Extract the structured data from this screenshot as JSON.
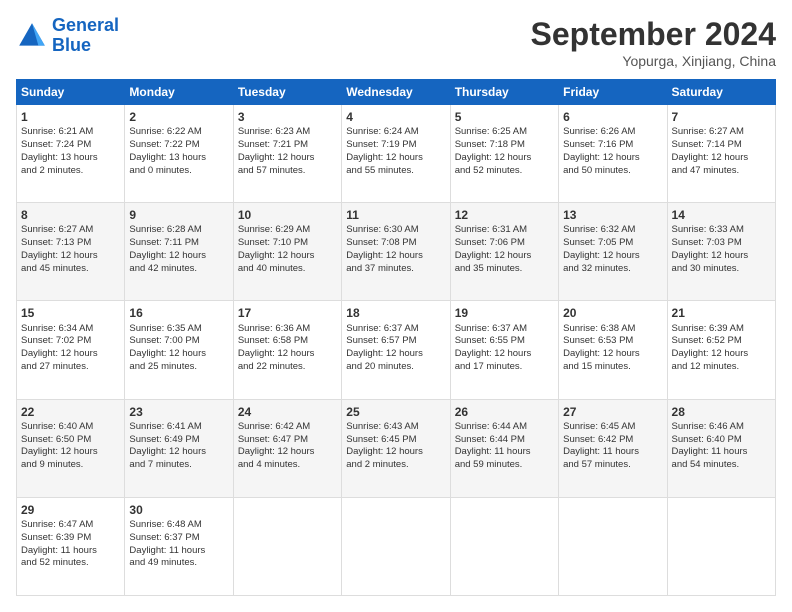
{
  "header": {
    "logo_line1": "General",
    "logo_line2": "Blue",
    "month_title": "September 2024",
    "subtitle": "Yopurga, Xinjiang, China"
  },
  "days_of_week": [
    "Sunday",
    "Monday",
    "Tuesday",
    "Wednesday",
    "Thursday",
    "Friday",
    "Saturday"
  ],
  "weeks": [
    [
      {
        "day": "1",
        "lines": [
          "Sunrise: 6:21 AM",
          "Sunset: 7:24 PM",
          "Daylight: 13 hours",
          "and 2 minutes."
        ]
      },
      {
        "day": "2",
        "lines": [
          "Sunrise: 6:22 AM",
          "Sunset: 7:22 PM",
          "Daylight: 13 hours",
          "and 0 minutes."
        ]
      },
      {
        "day": "3",
        "lines": [
          "Sunrise: 6:23 AM",
          "Sunset: 7:21 PM",
          "Daylight: 12 hours",
          "and 57 minutes."
        ]
      },
      {
        "day": "4",
        "lines": [
          "Sunrise: 6:24 AM",
          "Sunset: 7:19 PM",
          "Daylight: 12 hours",
          "and 55 minutes."
        ]
      },
      {
        "day": "5",
        "lines": [
          "Sunrise: 6:25 AM",
          "Sunset: 7:18 PM",
          "Daylight: 12 hours",
          "and 52 minutes."
        ]
      },
      {
        "day": "6",
        "lines": [
          "Sunrise: 6:26 AM",
          "Sunset: 7:16 PM",
          "Daylight: 12 hours",
          "and 50 minutes."
        ]
      },
      {
        "day": "7",
        "lines": [
          "Sunrise: 6:27 AM",
          "Sunset: 7:14 PM",
          "Daylight: 12 hours",
          "and 47 minutes."
        ]
      }
    ],
    [
      {
        "day": "8",
        "lines": [
          "Sunrise: 6:27 AM",
          "Sunset: 7:13 PM",
          "Daylight: 12 hours",
          "and 45 minutes."
        ]
      },
      {
        "day": "9",
        "lines": [
          "Sunrise: 6:28 AM",
          "Sunset: 7:11 PM",
          "Daylight: 12 hours",
          "and 42 minutes."
        ]
      },
      {
        "day": "10",
        "lines": [
          "Sunrise: 6:29 AM",
          "Sunset: 7:10 PM",
          "Daylight: 12 hours",
          "and 40 minutes."
        ]
      },
      {
        "day": "11",
        "lines": [
          "Sunrise: 6:30 AM",
          "Sunset: 7:08 PM",
          "Daylight: 12 hours",
          "and 37 minutes."
        ]
      },
      {
        "day": "12",
        "lines": [
          "Sunrise: 6:31 AM",
          "Sunset: 7:06 PM",
          "Daylight: 12 hours",
          "and 35 minutes."
        ]
      },
      {
        "day": "13",
        "lines": [
          "Sunrise: 6:32 AM",
          "Sunset: 7:05 PM",
          "Daylight: 12 hours",
          "and 32 minutes."
        ]
      },
      {
        "day": "14",
        "lines": [
          "Sunrise: 6:33 AM",
          "Sunset: 7:03 PM",
          "Daylight: 12 hours",
          "and 30 minutes."
        ]
      }
    ],
    [
      {
        "day": "15",
        "lines": [
          "Sunrise: 6:34 AM",
          "Sunset: 7:02 PM",
          "Daylight: 12 hours",
          "and 27 minutes."
        ]
      },
      {
        "day": "16",
        "lines": [
          "Sunrise: 6:35 AM",
          "Sunset: 7:00 PM",
          "Daylight: 12 hours",
          "and 25 minutes."
        ]
      },
      {
        "day": "17",
        "lines": [
          "Sunrise: 6:36 AM",
          "Sunset: 6:58 PM",
          "Daylight: 12 hours",
          "and 22 minutes."
        ]
      },
      {
        "day": "18",
        "lines": [
          "Sunrise: 6:37 AM",
          "Sunset: 6:57 PM",
          "Daylight: 12 hours",
          "and 20 minutes."
        ]
      },
      {
        "day": "19",
        "lines": [
          "Sunrise: 6:37 AM",
          "Sunset: 6:55 PM",
          "Daylight: 12 hours",
          "and 17 minutes."
        ]
      },
      {
        "day": "20",
        "lines": [
          "Sunrise: 6:38 AM",
          "Sunset: 6:53 PM",
          "Daylight: 12 hours",
          "and 15 minutes."
        ]
      },
      {
        "day": "21",
        "lines": [
          "Sunrise: 6:39 AM",
          "Sunset: 6:52 PM",
          "Daylight: 12 hours",
          "and 12 minutes."
        ]
      }
    ],
    [
      {
        "day": "22",
        "lines": [
          "Sunrise: 6:40 AM",
          "Sunset: 6:50 PM",
          "Daylight: 12 hours",
          "and 9 minutes."
        ]
      },
      {
        "day": "23",
        "lines": [
          "Sunrise: 6:41 AM",
          "Sunset: 6:49 PM",
          "Daylight: 12 hours",
          "and 7 minutes."
        ]
      },
      {
        "day": "24",
        "lines": [
          "Sunrise: 6:42 AM",
          "Sunset: 6:47 PM",
          "Daylight: 12 hours",
          "and 4 minutes."
        ]
      },
      {
        "day": "25",
        "lines": [
          "Sunrise: 6:43 AM",
          "Sunset: 6:45 PM",
          "Daylight: 12 hours",
          "and 2 minutes."
        ]
      },
      {
        "day": "26",
        "lines": [
          "Sunrise: 6:44 AM",
          "Sunset: 6:44 PM",
          "Daylight: 11 hours",
          "and 59 minutes."
        ]
      },
      {
        "day": "27",
        "lines": [
          "Sunrise: 6:45 AM",
          "Sunset: 6:42 PM",
          "Daylight: 11 hours",
          "and 57 minutes."
        ]
      },
      {
        "day": "28",
        "lines": [
          "Sunrise: 6:46 AM",
          "Sunset: 6:40 PM",
          "Daylight: 11 hours",
          "and 54 minutes."
        ]
      }
    ],
    [
      {
        "day": "29",
        "lines": [
          "Sunrise: 6:47 AM",
          "Sunset: 6:39 PM",
          "Daylight: 11 hours",
          "and 52 minutes."
        ]
      },
      {
        "day": "30",
        "lines": [
          "Sunrise: 6:48 AM",
          "Sunset: 6:37 PM",
          "Daylight: 11 hours",
          "and 49 minutes."
        ]
      },
      null,
      null,
      null,
      null,
      null
    ]
  ]
}
